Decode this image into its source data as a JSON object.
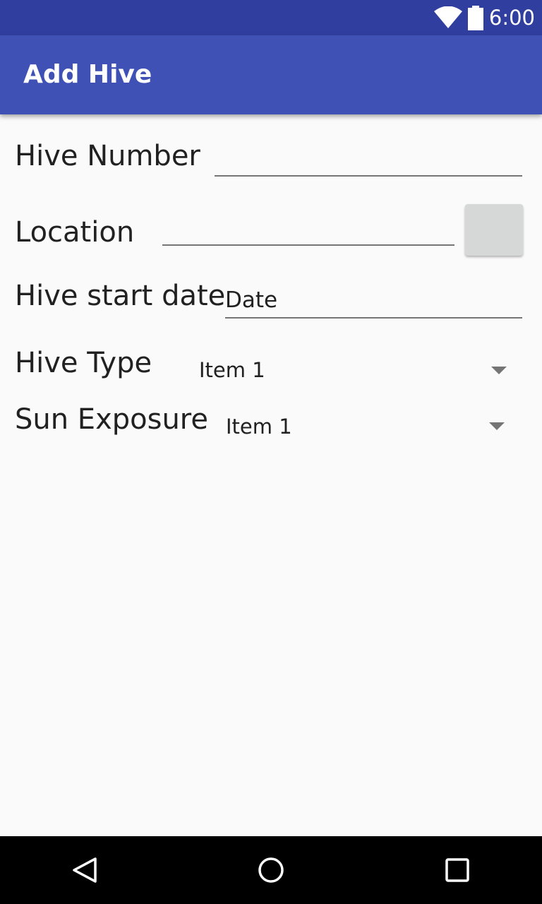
{
  "status_bar": {
    "time": "6:00",
    "icons": [
      "wifi-icon",
      "battery-icon"
    ],
    "color": "#303f9f"
  },
  "app_bar": {
    "title": "Add Hive",
    "color": "#3f51b5"
  },
  "form": {
    "hive_number": {
      "label": "Hive Number",
      "value": ""
    },
    "location": {
      "label": "Location",
      "value": ""
    },
    "hive_start_date": {
      "label": "Hive start date",
      "value": "Date"
    },
    "hive_type": {
      "label": "Hive Type",
      "selected": "Item 1"
    },
    "sun_exposure": {
      "label": "Sun Exposure",
      "selected": "Item 1"
    }
  },
  "nav_bar": {
    "icons": [
      "back-icon",
      "home-icon",
      "recents-icon"
    ]
  }
}
